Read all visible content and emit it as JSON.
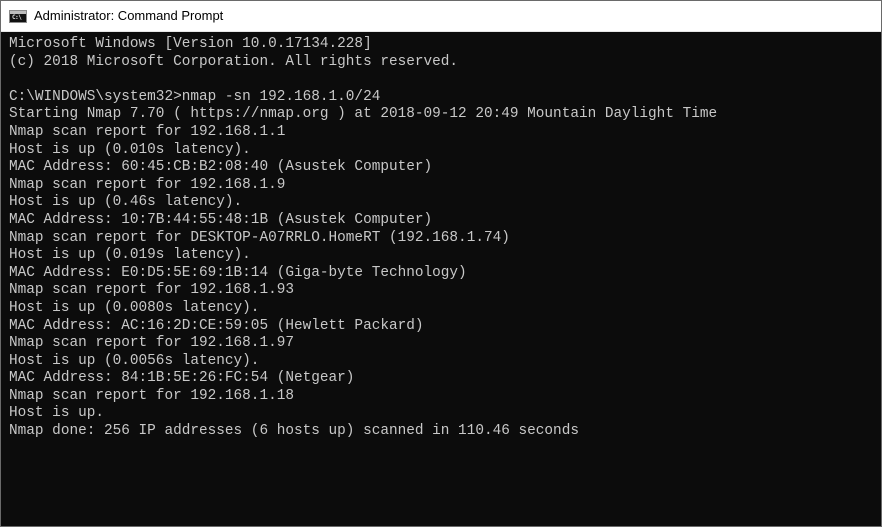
{
  "window": {
    "title": "Administrator: Command Prompt",
    "icon_name": "console-app-icon",
    "icon_text": "C:\\",
    "background_color": "#0c0c0c",
    "text_color": "#c8c8c8"
  },
  "console": {
    "lines": [
      "Microsoft Windows [Version 10.0.17134.228]",
      "(c) 2018 Microsoft Corporation. All rights reserved.",
      "",
      "C:\\WINDOWS\\system32>nmap -sn 192.168.1.0/24",
      "Starting Nmap 7.70 ( https://nmap.org ) at 2018-09-12 20:49 Mountain Daylight Time",
      "Nmap scan report for 192.168.1.1",
      "Host is up (0.010s latency).",
      "MAC Address: 60:45:CB:B2:08:40 (Asustek Computer)",
      "Nmap scan report for 192.168.1.9",
      "Host is up (0.46s latency).",
      "MAC Address: 10:7B:44:55:48:1B (Asustek Computer)",
      "Nmap scan report for DESKTOP-A07RRLO.HomeRT (192.168.1.74)",
      "Host is up (0.019s latency).",
      "MAC Address: E0:D5:5E:69:1B:14 (Giga-byte Technology)",
      "Nmap scan report for 192.168.1.93",
      "Host is up (0.0080s latency).",
      "MAC Address: AC:16:2D:CE:59:05 (Hewlett Packard)",
      "Nmap scan report for 192.168.1.97",
      "Host is up (0.0056s latency).",
      "MAC Address: 84:1B:5E:26:FC:54 (Netgear)",
      "Nmap scan report for 192.168.1.18",
      "Host is up.",
      "Nmap done: 256 IP addresses (6 hosts up) scanned in 110.46 seconds"
    ]
  }
}
